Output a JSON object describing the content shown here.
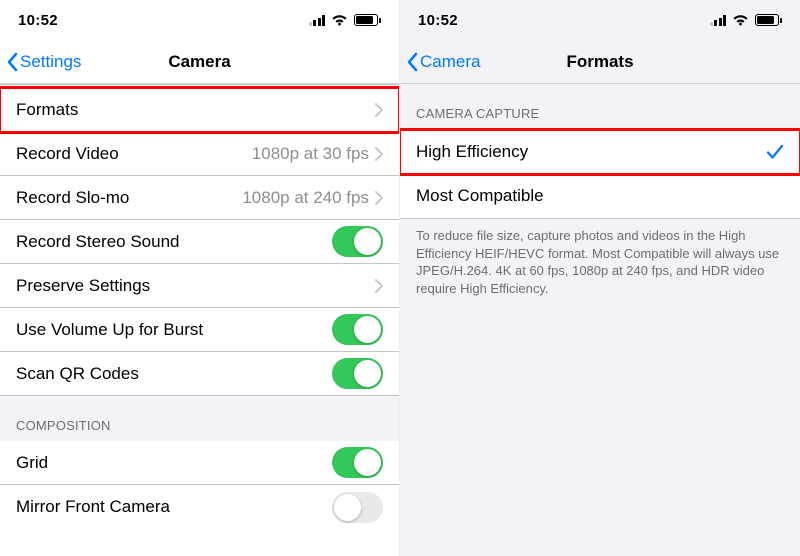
{
  "left": {
    "status": {
      "time": "10:52"
    },
    "nav": {
      "back": "Settings",
      "title": "Camera"
    },
    "rows": {
      "formats": {
        "label": "Formats"
      },
      "record_video": {
        "label": "Record Video",
        "detail": "1080p at 30 fps"
      },
      "record_slomo": {
        "label": "Record Slo-mo",
        "detail": "1080p at 240 fps"
      },
      "stereo": {
        "label": "Record Stereo Sound",
        "on": true
      },
      "preserve": {
        "label": "Preserve Settings"
      },
      "volume_burst": {
        "label": "Use Volume Up for Burst",
        "on": true
      },
      "scan_qr": {
        "label": "Scan QR Codes",
        "on": true
      },
      "composition_header": "COMPOSITION",
      "grid": {
        "label": "Grid",
        "on": true
      },
      "mirror": {
        "label": "Mirror Front Camera",
        "on": false
      }
    }
  },
  "right": {
    "status": {
      "time": "10:52"
    },
    "nav": {
      "back": "Camera",
      "title": "Formats"
    },
    "section_header": "CAMERA CAPTURE",
    "rows": {
      "high_eff": {
        "label": "High Efficiency",
        "selected": true
      },
      "most_compat": {
        "label": "Most Compatible",
        "selected": false
      }
    },
    "footer": "To reduce file size, capture photos and videos in the High Efficiency HEIF/HEVC format. Most Compatible will always use JPEG/H.264. 4K at 60 fps, 1080p at 240 fps, and HDR video require High Efficiency."
  }
}
